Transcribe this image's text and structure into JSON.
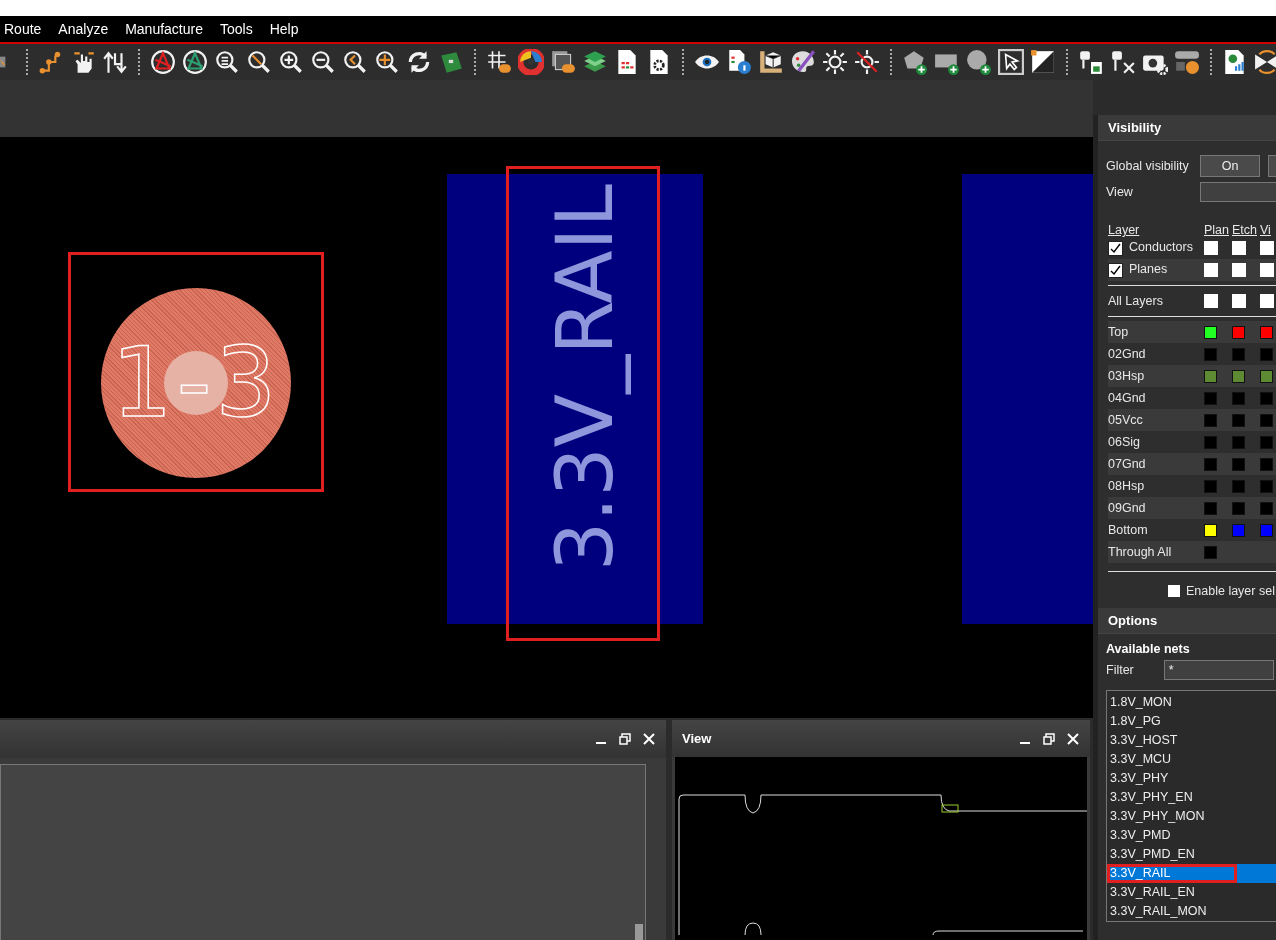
{
  "menu": [
    {
      "label": "Route"
    },
    {
      "label": "Analyze"
    },
    {
      "label": "Manufacture"
    },
    {
      "label": "Tools"
    },
    {
      "label": "Help"
    }
  ],
  "canvas": {
    "pad": {
      "label": "1-3",
      "highlighted": true
    },
    "traces": [
      {
        "label": "3.3V_RAIL",
        "highlighted": true
      },
      {
        "highlighted": false
      }
    ]
  },
  "visibility": {
    "title": "Visibility",
    "global_label": "Global visibility",
    "global_buttons": [
      "On"
    ],
    "view_label": "View",
    "columns": [
      "Layer",
      "Plan",
      "Etch",
      "Vi"
    ],
    "groups": [
      {
        "label": "Conductors",
        "checked": true,
        "cells": [
          {
            "checked": false
          },
          {
            "checked": false
          },
          {
            "checked": false
          }
        ]
      },
      {
        "label": "Planes",
        "checked": true,
        "cells": [
          {
            "checked": false
          },
          {
            "checked": false
          },
          {
            "checked": false
          }
        ]
      }
    ],
    "all_layers": {
      "label": "All Layers",
      "cells": [
        {
          "checked": false
        },
        {
          "checked": false
        },
        {
          "checked": false
        }
      ]
    },
    "layers": [
      {
        "name": "Top",
        "swatches": [
          {
            "color": "#22ff22"
          },
          {
            "color": "#ff0000"
          },
          {
            "color": "#ff0000"
          }
        ]
      },
      {
        "name": "02Gnd",
        "swatches": [
          {
            "color": "#000000"
          },
          {
            "color": "#000000"
          },
          {
            "color": "#000000"
          }
        ]
      },
      {
        "name": "03Hsp",
        "swatches": [
          {
            "color": "#5e8a34"
          },
          {
            "color": "#5e8a34"
          },
          {
            "color": "#5e8a34"
          }
        ]
      },
      {
        "name": "04Gnd",
        "swatches": [
          {
            "color": "#000000"
          },
          {
            "color": "#000000"
          },
          {
            "color": "#000000"
          }
        ]
      },
      {
        "name": "05Vcc",
        "swatches": [
          {
            "color": "#000000"
          },
          {
            "color": "#000000"
          },
          {
            "color": "#000000"
          }
        ]
      },
      {
        "name": "06Sig",
        "swatches": [
          {
            "color": "#000000"
          },
          {
            "color": "#000000"
          },
          {
            "color": "#000000"
          }
        ]
      },
      {
        "name": "07Gnd",
        "swatches": [
          {
            "color": "#000000"
          },
          {
            "color": "#000000"
          },
          {
            "color": "#000000"
          }
        ]
      },
      {
        "name": "08Hsp",
        "swatches": [
          {
            "color": "#000000"
          },
          {
            "color": "#000000"
          },
          {
            "color": "#000000"
          }
        ]
      },
      {
        "name": "09Gnd",
        "swatches": [
          {
            "color": "#000000"
          },
          {
            "color": "#000000"
          },
          {
            "color": "#000000"
          }
        ]
      },
      {
        "name": "Bottom",
        "swatches": [
          {
            "color": "#ffff00"
          },
          {
            "color": "#0000ff"
          },
          {
            "color": "#0000ff"
          }
        ]
      },
      {
        "name": "Through All",
        "swatches": [
          {
            "color": "#000000"
          }
        ]
      }
    ],
    "enable": {
      "label": "Enable layer sel",
      "checked": false
    }
  },
  "options": {
    "title": "Options",
    "nets_title": "Available nets",
    "filter_label": "Filter",
    "filter_value": "*",
    "nets": [
      {
        "name": "1.8V_MON",
        "selected": false,
        "highlighted": false
      },
      {
        "name": "1.8V_PG",
        "selected": false,
        "highlighted": false
      },
      {
        "name": "3.3V_HOST",
        "selected": false,
        "highlighted": false
      },
      {
        "name": "3.3V_MCU",
        "selected": false,
        "highlighted": false
      },
      {
        "name": "3.3V_PHY",
        "selected": false,
        "highlighted": false
      },
      {
        "name": "3.3V_PHY_EN",
        "selected": false,
        "highlighted": false
      },
      {
        "name": "3.3V_PHY_MON",
        "selected": false,
        "highlighted": false
      },
      {
        "name": "3.3V_PMD",
        "selected": false,
        "highlighted": false
      },
      {
        "name": "3.3V_PMD_EN",
        "selected": false,
        "highlighted": false
      },
      {
        "name": "3.3V_RAIL",
        "selected": true,
        "highlighted": true
      },
      {
        "name": "3.3V_RAIL_EN",
        "selected": false,
        "highlighted": false
      },
      {
        "name": "3.3V_RAIL_MON",
        "selected": false,
        "highlighted": false
      }
    ]
  },
  "view_panel": {
    "title": "View"
  }
}
